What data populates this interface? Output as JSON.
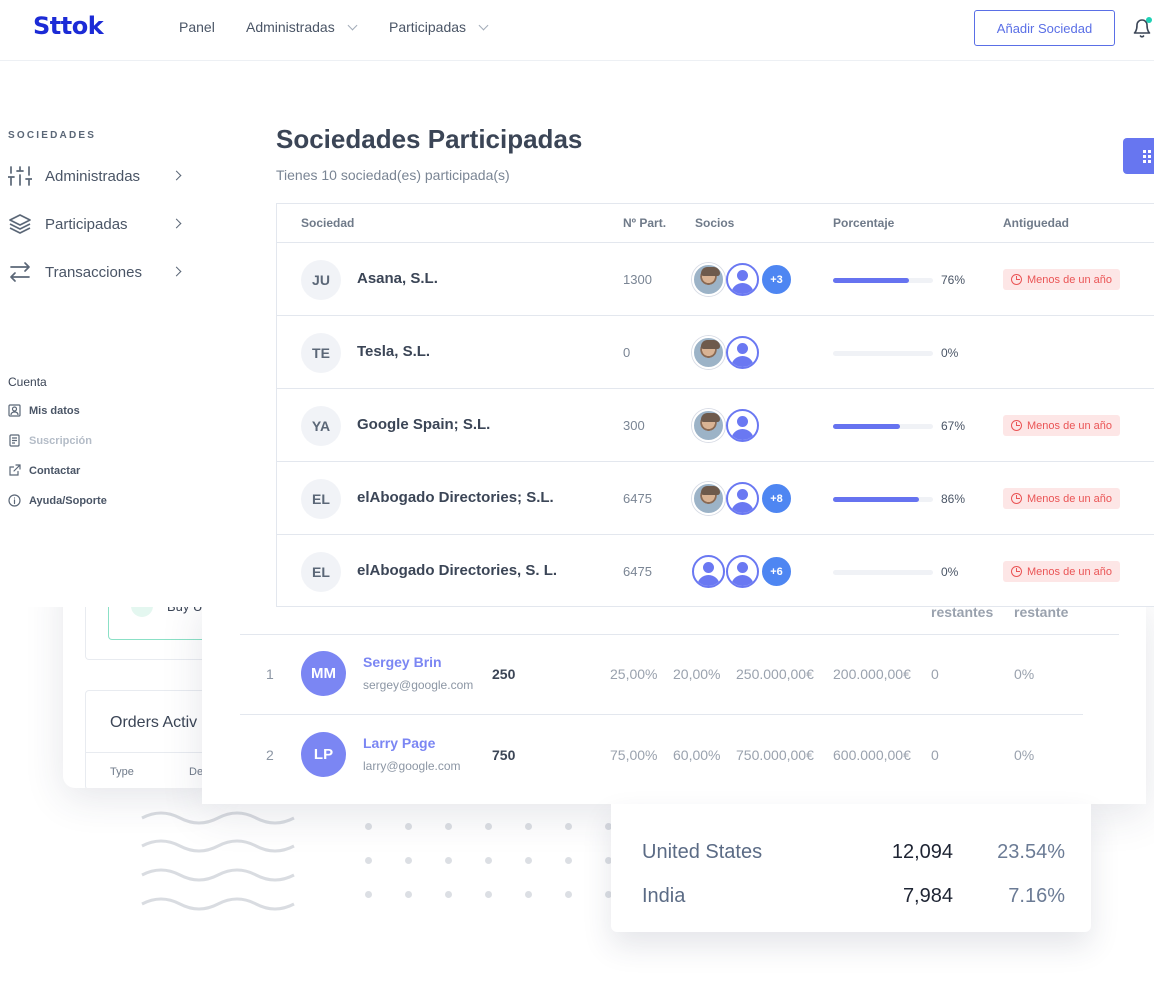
{
  "header": {
    "logo": "Sttok",
    "nav": [
      "Panel",
      "Administradas",
      "Participadas"
    ],
    "add_button": "Añadir Sociedad",
    "accent_color": "#1c2bd6",
    "notification_dot_color": "#1fd1b5"
  },
  "sidebar": {
    "section_title": "SOCIEDADES",
    "items": [
      {
        "label": "Administradas",
        "icon": "sliders-icon"
      },
      {
        "label": "Participadas",
        "icon": "layers-icon"
      },
      {
        "label": "Transacciones",
        "icon": "arrows-exchange-icon"
      }
    ],
    "account_title": "Cuenta",
    "account_items": [
      {
        "label": "Mis datos",
        "icon": "user-icon"
      },
      {
        "label": "Suscripción",
        "icon": "file-icon"
      },
      {
        "label": "Contactar",
        "icon": "external-link-icon"
      },
      {
        "label": "Ayuda/Soporte",
        "icon": "info-icon"
      }
    ]
  },
  "main": {
    "title": "Sociedades Participadas",
    "subtitle": "Tienes 10 sociedad(es) participada(s)",
    "columns": [
      "Sociedad",
      "Nº Part.",
      "Socios",
      "Porcentaje",
      "Antiguedad"
    ],
    "rows": [
      {
        "initials": "JU",
        "name": "Asana, S.L.",
        "parts": "1300",
        "avatars": [
          "photo",
          "blank"
        ],
        "more": "+3",
        "percent_value": 76,
        "percent": "76%",
        "age": "Menos de un año"
      },
      {
        "initials": "TE",
        "name": "Tesla, S.L.",
        "parts": "0",
        "avatars": [
          "photo",
          "blank"
        ],
        "more": "",
        "percent_value": 0,
        "percent": "0%",
        "age": ""
      },
      {
        "initials": "YA",
        "name": "Google Spain; S.L.",
        "parts": "300",
        "avatars": [
          "photo",
          "blank"
        ],
        "more": "",
        "percent_value": 67,
        "percent": "67%",
        "age": "Menos de un año"
      },
      {
        "initials": "EL",
        "name": "elAbogado Directories; S.L.",
        "parts": "6475",
        "avatars": [
          "photo",
          "blank"
        ],
        "more": "+8",
        "percent_value": 86,
        "percent": "86%",
        "age": "Menos de un año"
      },
      {
        "initials": "EL",
        "name": "elAbogado Directories, S. L.",
        "parts": "6475",
        "avatars": [
          "blank",
          "blank"
        ],
        "more": "+6",
        "percent_value": 0,
        "percent": "0%",
        "age": "Menos de un año"
      }
    ]
  },
  "background": {
    "buy_label": "Buy U",
    "orders_title": "Orders Activ",
    "orders_columns": [
      "Type",
      "De"
    ],
    "shareholders_headers": [
      "restantes",
      "restante"
    ],
    "shareholders": [
      {
        "num": "1",
        "initials": "MM",
        "name": "Sergey Brin",
        "email": "sergey@google.com",
        "shares": "250",
        "v1": "25,00%",
        "v2": "20,00%",
        "v3": "250.000,00€",
        "v4": "200.000,00€",
        "v5": "0",
        "v6": "0%"
      },
      {
        "num": "2",
        "initials": "LP",
        "name": "Larry Page",
        "email": "larry@google.com",
        "shares": "750",
        "v1": "75,00%",
        "v2": "60,00%",
        "v3": "750.000,00€",
        "v4": "600.000,00€",
        "v5": "0",
        "v6": "0%"
      }
    ],
    "countries": [
      {
        "name": "United States",
        "value": "12,094",
        "pct": "23.54%"
      },
      {
        "name": "India",
        "value": "7,984",
        "pct": "7.16%"
      }
    ]
  }
}
